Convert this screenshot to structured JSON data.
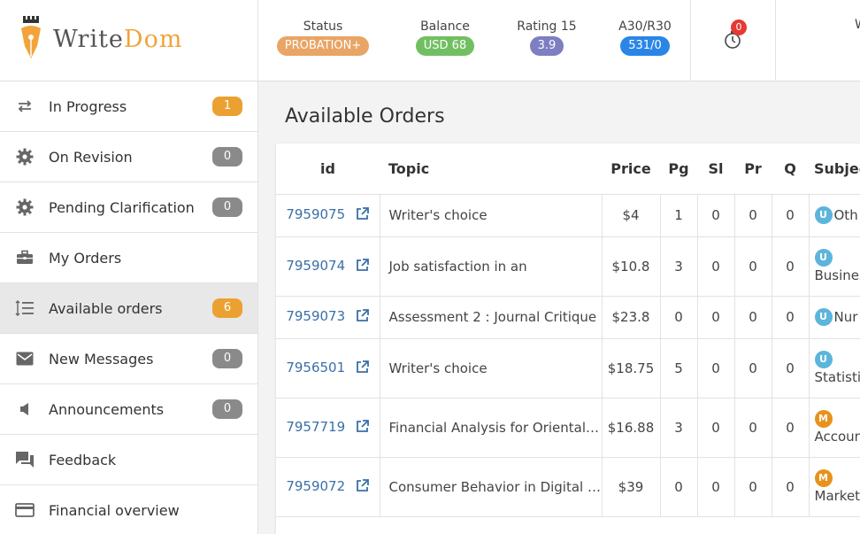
{
  "brand": {
    "write": "Write",
    "dom": "Dom"
  },
  "header": {
    "stats": [
      {
        "label": "Status",
        "value": "PROBATION+",
        "color": "#e8a566"
      },
      {
        "label": "Balance",
        "value": "USD 68",
        "color": "#72bf63"
      },
      {
        "label": "Rating 15",
        "value": "3.9",
        "color": "#7d7fc2"
      },
      {
        "label": "A30/R30",
        "value": "531/0",
        "color": "#2a86e6"
      }
    ],
    "notifications_count": "0",
    "truncated_label": "W"
  },
  "sidebar": {
    "items": [
      {
        "label": "In Progress",
        "count": "1",
        "icon": "repeat-icon"
      },
      {
        "label": "On Revision",
        "count": "0",
        "icon": "gear-icon"
      },
      {
        "label": "Pending Clarification",
        "count": "0",
        "icon": "gear-icon"
      },
      {
        "label": "My Orders",
        "count": "",
        "icon": "briefcase-icon"
      },
      {
        "label": "Available orders",
        "count": "6",
        "icon": "list-ordered-icon",
        "active": true
      },
      {
        "label": "New Messages",
        "count": "0",
        "icon": "envelope-icon"
      },
      {
        "label": "Announcements",
        "count": "0",
        "icon": "megaphone-icon"
      },
      {
        "label": "Feedback",
        "count": "",
        "icon": "chat-icon"
      },
      {
        "label": "Financial overview",
        "count": "",
        "icon": "credit-card-icon"
      }
    ]
  },
  "main": {
    "title": "Available Orders",
    "columns": [
      "id",
      "Topic",
      "Price",
      "Pg",
      "Sl",
      "Pr",
      "Q",
      "Subjec"
    ],
    "rows": [
      {
        "id": "7959075",
        "topic": "Writer's choice",
        "price": "$4",
        "pg": "1",
        "sl": "0",
        "pr": "0",
        "q": "0",
        "level": "U",
        "subject": "Oth"
      },
      {
        "id": "7959074",
        "topic": "Job satisfaction in an",
        "price": "$10.8",
        "pg": "3",
        "sl": "0",
        "pr": "0",
        "q": "0",
        "level": "U",
        "subject": "Busines"
      },
      {
        "id": "7959073",
        "topic": "Assessment 2 : Journal Critique",
        "price": "$23.8",
        "pg": "0",
        "sl": "0",
        "pr": "0",
        "q": "0",
        "level": "U",
        "subject": "Nur"
      },
      {
        "id": "7956501",
        "topic": "Writer's choice",
        "price": "$18.75",
        "pg": "5",
        "sl": "0",
        "pr": "0",
        "q": "0",
        "level": "U",
        "subject": "Statisti"
      },
      {
        "id": "7957719",
        "topic": "Financial Analysis for Oriental …",
        "price": "$16.88",
        "pg": "3",
        "sl": "0",
        "pr": "0",
        "q": "0",
        "level": "M",
        "subject": "Accoun"
      },
      {
        "id": "7959072",
        "topic": "Consumer Behavior in Digital …",
        "price": "$39",
        "pg": "0",
        "sl": "0",
        "pr": "0",
        "q": "0",
        "level": "M",
        "subject": "Market"
      }
    ]
  }
}
